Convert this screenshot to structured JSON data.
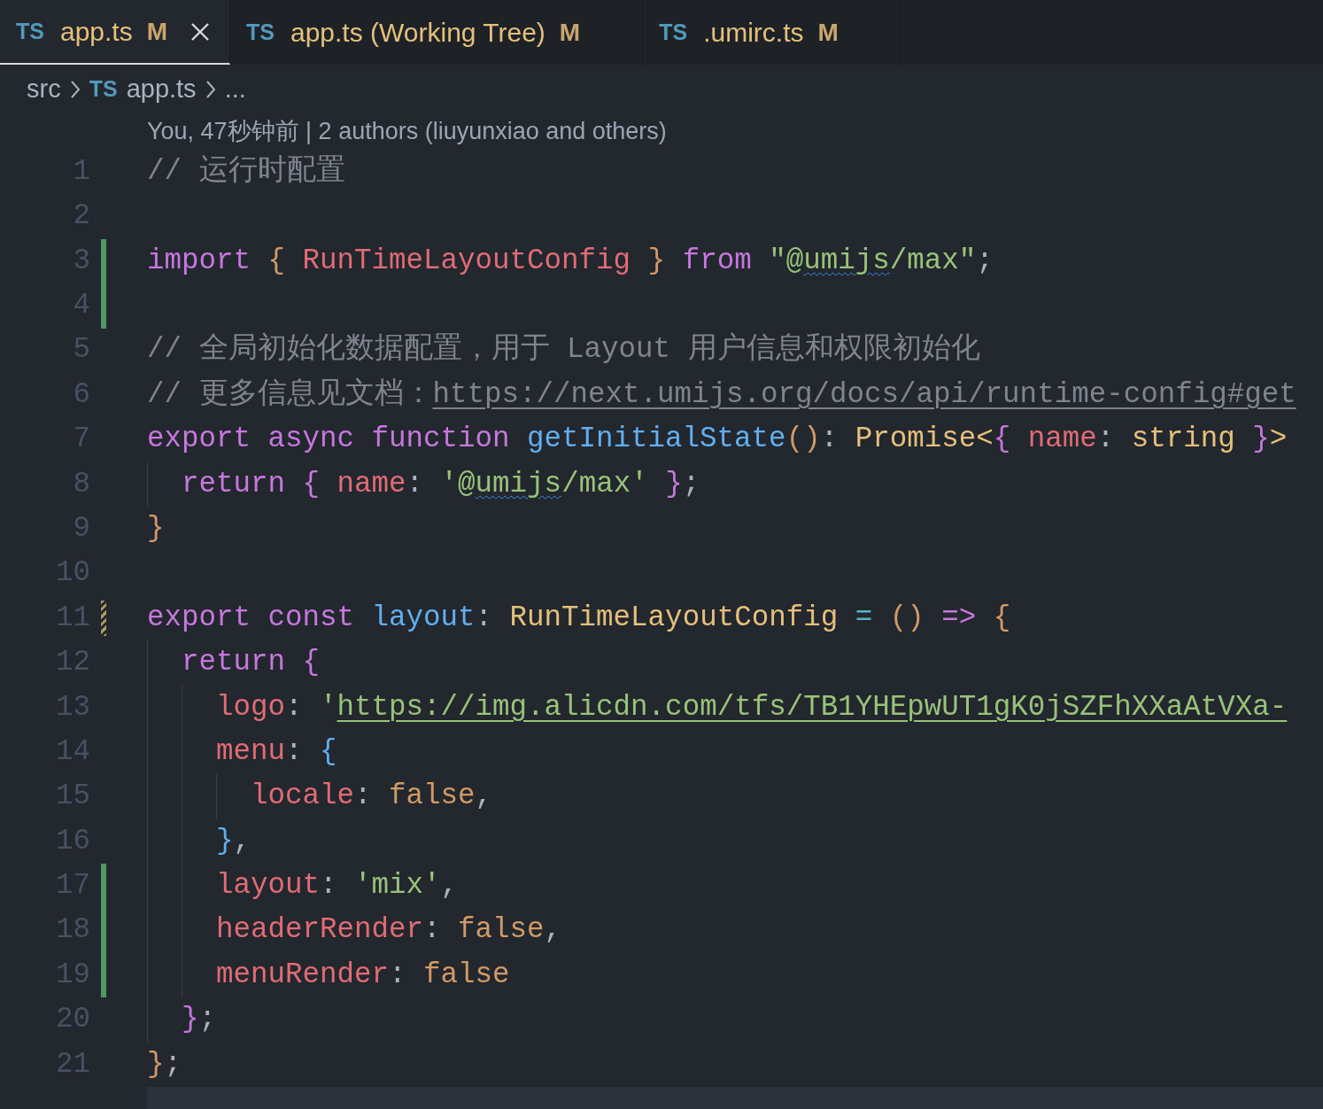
{
  "tabs": [
    {
      "icon": "TS",
      "label": "app.ts",
      "status": "M",
      "selected": true
    },
    {
      "icon": "TS",
      "label": "app.ts (Working Tree)",
      "status": "M",
      "selected": false
    },
    {
      "icon": "TS",
      "label": ".umirc.ts",
      "status": "M",
      "selected": false
    }
  ],
  "breadcrumb": {
    "folder": "src",
    "icon": "TS",
    "file": "app.ts",
    "more": "..."
  },
  "blame": "You, 47秒钟前 | 2 authors (liuyunxiao and others)",
  "lines": [
    {
      "number": "1",
      "added": false,
      "modified": false,
      "tokens": [
        {
          "text": "// 运行时配置",
          "kind": "comment"
        }
      ]
    },
    {
      "number": "2",
      "added": false,
      "modified": false
    },
    {
      "number": "3",
      "added": true,
      "modified": false,
      "tokens": [
        {
          "text": "import ",
          "kind": "keyword"
        },
        {
          "text": "{ ",
          "kind": "bracket1"
        },
        {
          "text": "RunTimeLayoutConfig",
          "kind": "variable"
        },
        {
          "text": " } ",
          "kind": "bracket1"
        },
        {
          "text": "from ",
          "kind": "keyword"
        },
        {
          "text": "\"@",
          "kind": "string"
        },
        {
          "text": "umijs",
          "kind": "string-squiggle"
        },
        {
          "text": "/max\"",
          "kind": "string"
        },
        {
          "text": ";",
          "kind": "punct"
        }
      ]
    },
    {
      "number": "4",
      "added": true,
      "modified": false
    },
    {
      "number": "5",
      "added": false,
      "modified": false,
      "tokens": [
        {
          "text": "// 全局初始化数据配置，用于 Layout 用户信息和权限初始化",
          "kind": "comment"
        }
      ]
    },
    {
      "number": "6",
      "added": false,
      "modified": false,
      "tokens": [
        {
          "text": "// 更多信息见文档：",
          "kind": "comment"
        },
        {
          "text": "https://next.umijs.org/docs/api/runtime-config#get",
          "kind": "comment-link"
        }
      ]
    },
    {
      "number": "7",
      "added": false,
      "modified": false,
      "tokens": [
        {
          "text": "export async function ",
          "kind": "keyword"
        },
        {
          "text": "getInitialState",
          "kind": "function"
        },
        {
          "text": "()",
          "kind": "bracket1"
        },
        {
          "text": ": ",
          "kind": "punct"
        },
        {
          "text": "Promise",
          "kind": "type"
        },
        {
          "text": "<",
          "kind": "type"
        },
        {
          "text": "{ ",
          "kind": "bracket2"
        },
        {
          "text": "name",
          "kind": "variable"
        },
        {
          "text": ": ",
          "kind": "punct"
        },
        {
          "text": "string ",
          "kind": "type"
        },
        {
          "text": "}",
          "kind": "bracket2"
        },
        {
          "text": ">",
          "kind": "type"
        }
      ]
    },
    {
      "number": "8",
      "added": false,
      "modified": false,
      "tokens": [
        {
          "text": "  return ",
          "kind": "keyword"
        },
        {
          "text": "{ ",
          "kind": "bracket2"
        },
        {
          "text": "name",
          "kind": "variable"
        },
        {
          "text": ": ",
          "kind": "punct"
        },
        {
          "text": "'@",
          "kind": "string"
        },
        {
          "text": "umijs",
          "kind": "string-squiggle"
        },
        {
          "text": "/max' ",
          "kind": "string"
        },
        {
          "text": "}",
          "kind": "bracket2"
        },
        {
          "text": ";",
          "kind": "punct"
        }
      ]
    },
    {
      "number": "9",
      "added": false,
      "modified": false,
      "tokens": [
        {
          "text": "}",
          "kind": "bracket1"
        }
      ]
    },
    {
      "number": "10",
      "added": false,
      "modified": false
    },
    {
      "number": "11",
      "added": false,
      "modified": true,
      "tokens": [
        {
          "text": "export const ",
          "kind": "keyword"
        },
        {
          "text": "layout",
          "kind": "function"
        },
        {
          "text": ": ",
          "kind": "punct"
        },
        {
          "text": "RunTimeLayoutConfig ",
          "kind": "type"
        },
        {
          "text": "= ",
          "kind": "operator"
        },
        {
          "text": "() ",
          "kind": "bracket1"
        },
        {
          "text": "=> ",
          "kind": "keyword"
        },
        {
          "text": "{",
          "kind": "bracket1"
        }
      ]
    },
    {
      "number": "12",
      "added": false,
      "modified": false,
      "tokens": [
        {
          "text": "  return ",
          "kind": "keyword"
        },
        {
          "text": "{",
          "kind": "bracket2"
        }
      ]
    },
    {
      "number": "13",
      "added": false,
      "modified": false,
      "tokens": [
        {
          "text": "    logo",
          "kind": "variable"
        },
        {
          "text": ": ",
          "kind": "punct"
        },
        {
          "text": "'",
          "kind": "string"
        },
        {
          "text": "https://img.alicdn.com/tfs/TB1YHEpwUT1gK0jSZFhXXaAtVXa-",
          "kind": "string-link"
        }
      ]
    },
    {
      "number": "14",
      "added": false,
      "modified": false,
      "tokens": [
        {
          "text": "    menu",
          "kind": "variable"
        },
        {
          "text": ": ",
          "kind": "punct"
        },
        {
          "text": "{",
          "kind": "bracket3"
        }
      ]
    },
    {
      "number": "15",
      "added": false,
      "modified": false,
      "tokens": [
        {
          "text": "      locale",
          "kind": "variable"
        },
        {
          "text": ": ",
          "kind": "punct"
        },
        {
          "text": "false",
          "kind": "constant"
        },
        {
          "text": ",",
          "kind": "punct"
        }
      ]
    },
    {
      "number": "16",
      "added": false,
      "modified": false,
      "tokens": [
        {
          "text": "    }",
          "kind": "bracket3"
        },
        {
          "text": ",",
          "kind": "punct"
        }
      ]
    },
    {
      "number": "17",
      "added": true,
      "modified": false,
      "tokens": [
        {
          "text": "    layout",
          "kind": "variable"
        },
        {
          "text": ": ",
          "kind": "punct"
        },
        {
          "text": "'mix'",
          "kind": "string"
        },
        {
          "text": ",",
          "kind": "punct"
        }
      ]
    },
    {
      "number": "18",
      "added": true,
      "modified": false,
      "tokens": [
        {
          "text": "    headerRender",
          "kind": "variable"
        },
        {
          "text": ": ",
          "kind": "punct"
        },
        {
          "text": "false",
          "kind": "constant"
        },
        {
          "text": ",",
          "kind": "punct"
        }
      ]
    },
    {
      "number": "19",
      "added": true,
      "modified": false,
      "tokens": [
        {
          "text": "    menuRender",
          "kind": "variable"
        },
        {
          "text": ": ",
          "kind": "punct"
        },
        {
          "text": "false",
          "kind": "constant"
        }
      ]
    },
    {
      "number": "20",
      "added": false,
      "modified": false,
      "tokens": [
        {
          "text": "  }",
          "kind": "bracket2"
        },
        {
          "text": ";",
          "kind": "punct"
        }
      ]
    },
    {
      "number": "21",
      "added": false,
      "modified": false,
      "tokens": [
        {
          "text": "}",
          "kind": "bracket1"
        },
        {
          "text": ";",
          "kind": "punct"
        }
      ]
    }
  ]
}
